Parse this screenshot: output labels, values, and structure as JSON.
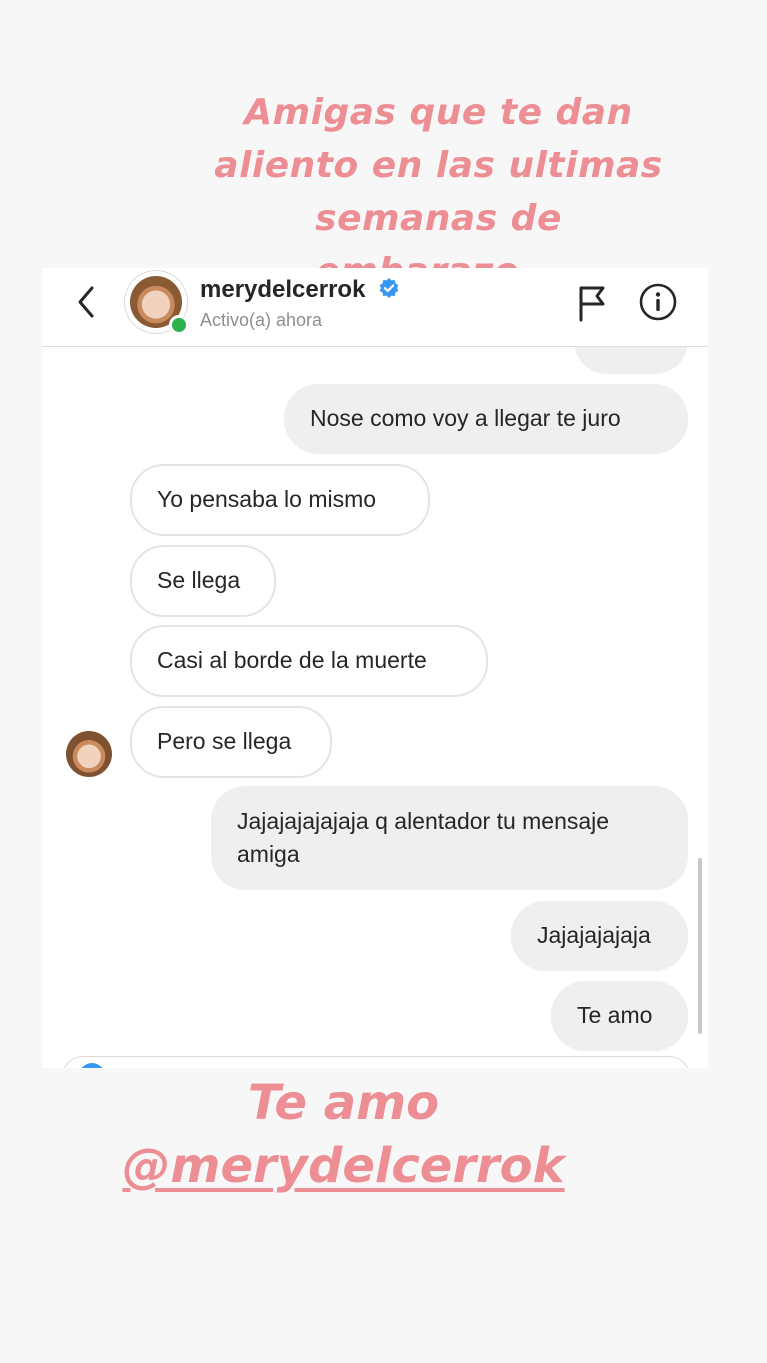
{
  "story": {
    "caption_top_lines": [
      "Amigas que te dan",
      "aliento en las ultimas",
      "semanas de",
      "embarazo..."
    ],
    "caption_bottom_line1": "Te amo",
    "caption_bottom_mention": "@merydelcerrok",
    "caption_color": "#ec8e93"
  },
  "header": {
    "back_icon": "chevron-left-icon",
    "username": "merydelcerrok",
    "verified": true,
    "status": "Activo(a) ahora",
    "actions": [
      "flag-icon",
      "info-icon"
    ]
  },
  "messages": [
    {
      "direction": "out",
      "text": "Nose como voy a llegar te juro"
    },
    {
      "direction": "in",
      "text": "Yo pensaba lo mismo"
    },
    {
      "direction": "in",
      "text": "Se llega"
    },
    {
      "direction": "in",
      "text": "Casi al borde de la muerte"
    },
    {
      "direction": "in",
      "text": "Pero se llega"
    },
    {
      "direction": "out",
      "text": "Jajajajajajaja q alentador tu mensaje amiga"
    },
    {
      "direction": "out",
      "text": "Jajajajajaja"
    },
    {
      "direction": "out",
      "text": "Te amo"
    }
  ],
  "colors": {
    "outgoing_bubble": "#efefef",
    "incoming_border": "#e4e4e4",
    "online": "#2bb24c",
    "verified": "#3897f0"
  }
}
